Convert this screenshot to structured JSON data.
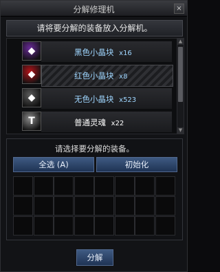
{
  "window": {
    "title": "分解修理机",
    "close_glyph": "×"
  },
  "instruction": "请将要分解的装备放入分解机。",
  "items": [
    {
      "name": "黑色小晶块",
      "count": "x16",
      "color": "#9fd6ff",
      "icon": "purple-crystal-icon",
      "icon_color": "#6a2a9a",
      "icon_glyph": "◆"
    },
    {
      "name": "红色小晶块",
      "count": "x8",
      "color": "#9fd6ff",
      "icon": "red-crystal-icon",
      "icon_color": "#b3141a",
      "icon_glyph": "◆"
    },
    {
      "name": "无色小晶块",
      "count": "x523",
      "color": "#9fd6ff",
      "icon": "gray-crystal-icon",
      "icon_color": "#5b5b5b",
      "icon_glyph": "◆"
    },
    {
      "name": "普通灵魂",
      "count": "x22",
      "color": "#ffffff",
      "icon": "soul-icon",
      "icon_color": "#8a8a8a",
      "icon_glyph": "T"
    }
  ],
  "select_panel": {
    "label": "请选择要分解的装备。"
  },
  "buttons": {
    "select_all": "全选 (A)",
    "reset": "初始化",
    "decompose": "分解"
  }
}
